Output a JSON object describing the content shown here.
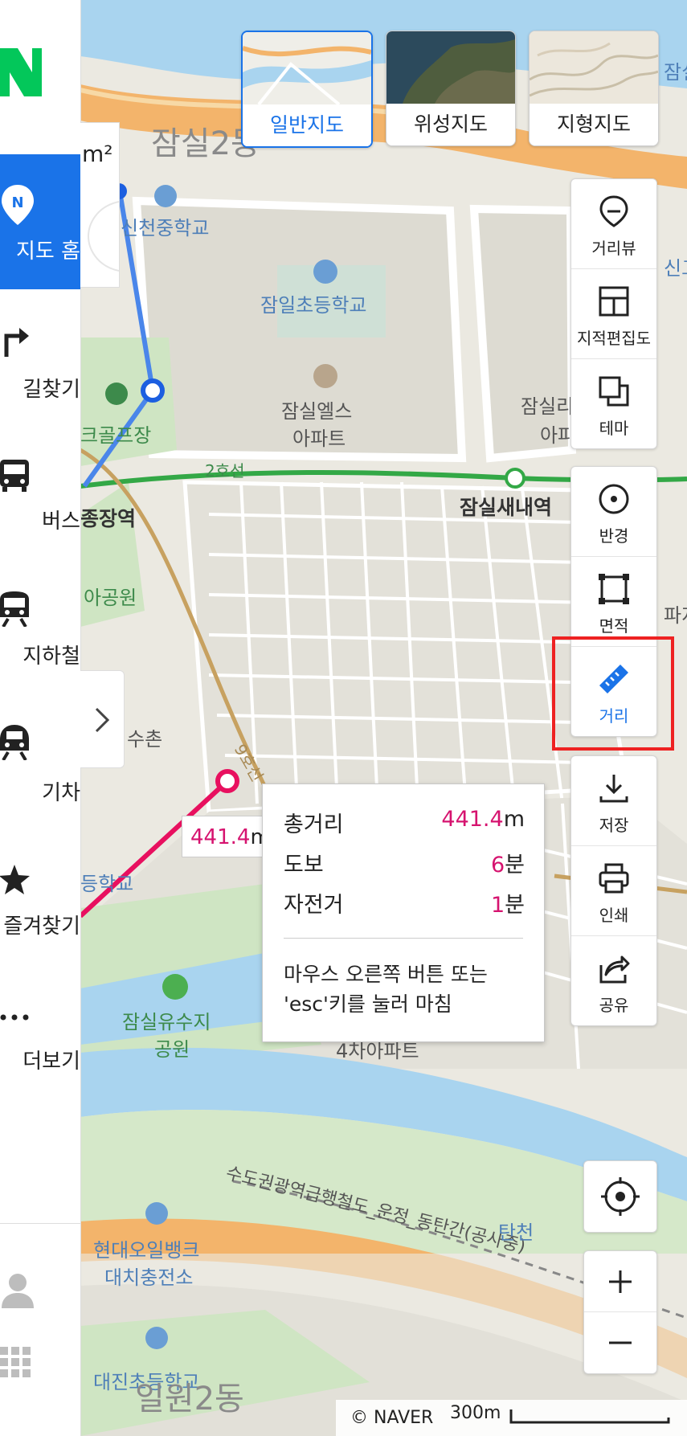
{
  "sidebar": {
    "items": [
      {
        "label": "지도 홈",
        "icon": "naver-pin-icon",
        "active": true
      },
      {
        "label": "길찾기",
        "icon": "turn-right-arrow-icon"
      },
      {
        "label": "버스",
        "icon": "bus-icon"
      },
      {
        "label": "지하철",
        "icon": "subway-icon"
      },
      {
        "label": "기차",
        "icon": "train-icon"
      },
      {
        "label": "즐겨찾기",
        "icon": "star-icon"
      },
      {
        "label": "더보기",
        "icon": "more-dots-icon"
      }
    ],
    "bottom_icons": [
      "user-icon",
      "apps-grid-icon"
    ]
  },
  "panel": {
    "unit_text": "m²"
  },
  "map_types": [
    {
      "label": "일반지도",
      "selected": true
    },
    {
      "label": "위성지도"
    },
    {
      "label": "지형지도"
    }
  ],
  "tools": {
    "group1": [
      {
        "label": "거리뷰",
        "icon": "street-view-pin-icon"
      },
      {
        "label": "지적편집도",
        "icon": "cadastral-grid-icon"
      },
      {
        "label": "테마",
        "icon": "theme-layers-icon"
      }
    ],
    "group2": [
      {
        "label": "반경",
        "icon": "radius-circle-icon"
      },
      {
        "label": "면적",
        "icon": "area-square-icon"
      },
      {
        "label": "거리",
        "icon": "ruler-icon",
        "active": true
      }
    ],
    "group3": [
      {
        "label": "저장",
        "icon": "download-icon"
      },
      {
        "label": "인쇄",
        "icon": "print-icon"
      },
      {
        "label": "공유",
        "icon": "share-icon"
      }
    ]
  },
  "measure": {
    "map_label": "441.4m",
    "rows": [
      {
        "label": "총거리",
        "value": "441.4",
        "unit": "m"
      },
      {
        "label": "도보",
        "value": "6",
        "unit": "분"
      },
      {
        "label": "자전거",
        "value": "1",
        "unit": "분"
      }
    ],
    "hint": "마우스 오른쪽 버튼 또는 'esc'키를 눌러 마침"
  },
  "map_labels": {
    "district_top": "잠실2동",
    "school1": "신천중학교",
    "school2": "잠일초등학교",
    "apt1_line1": "잠실엘스",
    "apt1_line2": "아파트",
    "apt2_line1": "잠실리",
    "apt2_line2": "아파",
    "golf": "크골프장",
    "line2": "2호선",
    "station1": "잠실새내역",
    "station2": "종장역",
    "park1": "아공원",
    "chon": "수촌",
    "line9": "9호선",
    "school3": "등학교",
    "reservoir_line1": "잠실유수지",
    "reservoir_line2": "공원",
    "apt3": "4차아파트",
    "rail": "수도권광역급행철도_운정_동탄간(공사중)",
    "tancheon": "탄천",
    "gas_line1": "현대오일뱅크",
    "gas_line2": "대치충전소",
    "school4": "대진초등학교",
    "district_bottom": "일원2동",
    "edge1": "잠실",
    "edge2": "신고",
    "edge3": "파지"
  },
  "footer": {
    "copyright": "© NAVER",
    "scale": "300m"
  },
  "colors": {
    "accent": "#1a73e8",
    "measure_line": "#e8105f",
    "highlight": "#e22222"
  }
}
